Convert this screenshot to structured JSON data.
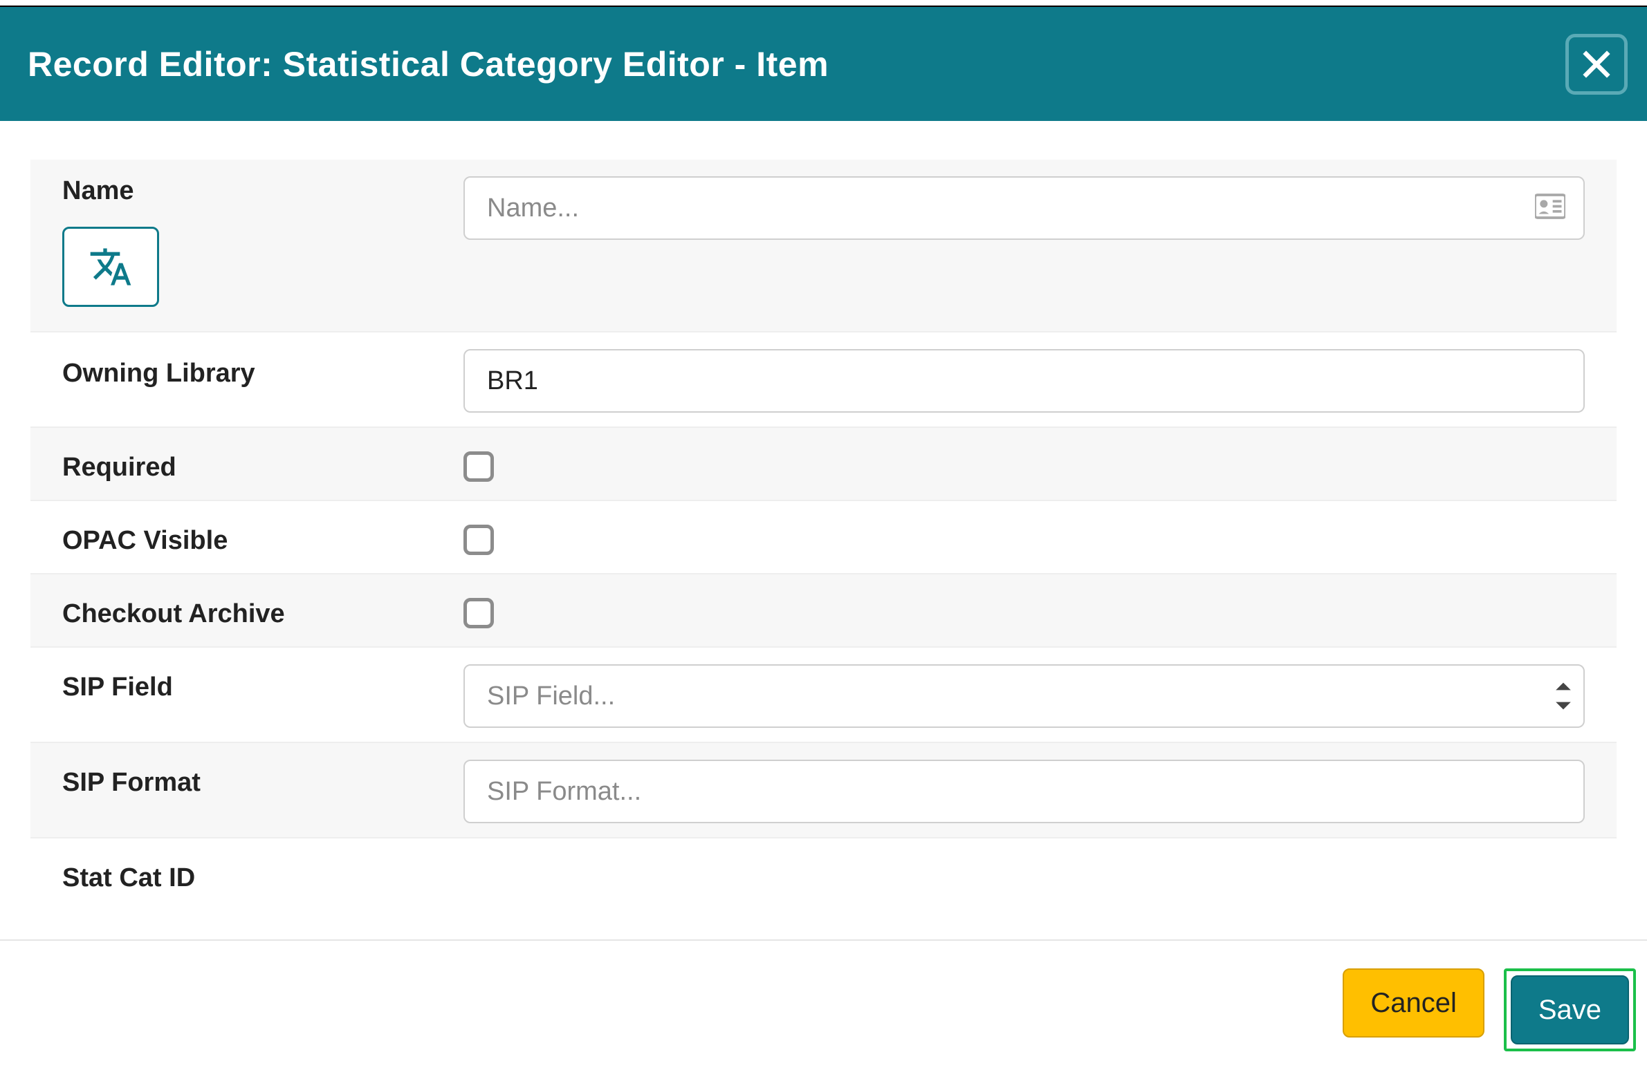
{
  "dialog": {
    "title": "Record Editor: Statistical Category Editor - Item"
  },
  "fields": {
    "name": {
      "label": "Name",
      "placeholder": "Name...",
      "value": ""
    },
    "owning_library": {
      "label": "Owning Library",
      "value": "BR1"
    },
    "required": {
      "label": "Required"
    },
    "opac_visible": {
      "label": "OPAC Visible"
    },
    "checkout_archive": {
      "label": "Checkout Archive"
    },
    "sip_field": {
      "label": "SIP Field",
      "placeholder": "SIP Field...",
      "value": ""
    },
    "sip_format": {
      "label": "SIP Format",
      "placeholder": "SIP Format...",
      "value": ""
    },
    "stat_cat_id": {
      "label": "Stat Cat ID"
    }
  },
  "buttons": {
    "cancel": "Cancel",
    "save": "Save"
  }
}
